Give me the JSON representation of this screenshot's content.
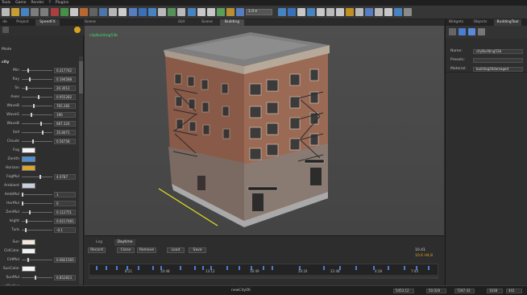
{
  "menubar": {
    "items": [
      "Tools",
      "Game",
      "Render",
      "?",
      "Plugins"
    ]
  },
  "toolbar": {
    "zoom_value": "1.0",
    "icons": [
      "file-icon",
      "open-icon",
      "save-icon",
      "undo-icon",
      "redo-icon",
      "cut-icon",
      "copy-icon",
      "paste-icon",
      "brush-icon",
      "terrain-icon",
      "link-icon",
      "fx-icon",
      "settings-icon",
      "select-icon",
      "move-icon",
      "rotate-icon",
      "scale-icon",
      "grid-icon",
      "snap-icon",
      "camera-icon",
      "text-icon",
      "lock-icon",
      "play-icon",
      "light-icon",
      "sky-icon",
      "water-icon",
      "wind-icon",
      "physics-icon",
      "render-icon",
      "sound-icon",
      "script-icon",
      "debug-icon",
      "layers-icon",
      "help-icon",
      "close-icon",
      "info-icon",
      "stats-icon",
      "fullscreen-icon",
      "options-icon"
    ]
  },
  "left_panel": {
    "tabs": [
      "de",
      "Project",
      "SpeedFX"
    ],
    "active_tab": 2,
    "section_mode": "Mode",
    "section_title": "city",
    "params": [
      {
        "label": "Min",
        "value": "0.217742",
        "knob": 0.2
      },
      {
        "label": "Ray",
        "value": "0.194588",
        "knob": 0.25
      },
      {
        "label": "Sn",
        "value": "20.3012",
        "knob": 0.15
      },
      {
        "label": "Axes",
        "value": "0.955282",
        "knob": 0.55
      },
      {
        "label": "WaveB",
        "value": "765.282",
        "knob": 0.4
      },
      {
        "label": "WaveG",
        "value": "190",
        "knob": 0.3
      },
      {
        "label": "WaveB",
        "value": "687.324",
        "knob": 0.65
      },
      {
        "label": "Sell",
        "value": "35.8471",
        "knob": 0.7
      },
      {
        "label": "Clouds",
        "value": "0.56758",
        "knob": 0.35
      }
    ],
    "colors": [
      {
        "label": "Fog",
        "color": "#f4f4f4"
      },
      {
        "label": "Zenith",
        "color": "#4a90d9"
      },
      {
        "label": "Horizon",
        "color": "#d9a62a"
      }
    ],
    "params2": [
      {
        "label": "FogMul",
        "value": "4.0787",
        "knob": 0.6
      },
      {
        "label": "Ambient",
        "value": "",
        "knob": null,
        "color": "#c8d0e0"
      },
      {
        "label": "AmbMul",
        "value": "1",
        "knob": 0.0
      },
      {
        "label": "HorMul",
        "value": "0",
        "knob": 0.0
      },
      {
        "label": "ZenMul",
        "value": "0.112751",
        "knob": 0.25
      },
      {
        "label": "Isight",
        "value": "0.0217481",
        "knob": 0.15
      },
      {
        "label": "Turb",
        "value": "-0.1",
        "knob": 0.1
      }
    ],
    "colors2": [
      {
        "label": "Sun",
        "color": "#f2e8dc"
      },
      {
        "label": "CldColor",
        "color": "#f0f0f0"
      },
      {
        "label": "CldMul",
        "value": "0.0821565",
        "knob": 0.2
      },
      {
        "label": "SunColor",
        "color": "#f4f4f4"
      },
      {
        "label": "SunMul",
        "value": "0.852823",
        "knob": 0.45
      },
      {
        "label": "pRadius",
        "value": "",
        "knob": null
      }
    ]
  },
  "viewport": {
    "tabs": [
      "Scene",
      "GUI",
      "Scene",
      "Building"
    ],
    "active_tab": 3,
    "info_label": "cityBuilding53b"
  },
  "timeline": {
    "tabs": [
      "Log",
      "Daytime"
    ],
    "active_tab": 1,
    "buttons": [
      "Record",
      "Clone",
      "Remove",
      "Load",
      "Save"
    ],
    "time_value": "10.41",
    "time_value2": "10.6 H4.8",
    "ticks": [
      "8:21",
      "10:48",
      "13:12",
      "16:49",
      "20:24",
      "22:48",
      "4:28",
      "7:44"
    ]
  },
  "right_panel": {
    "tabs": [
      "Widgets",
      "Objects",
      "BuildingTool"
    ],
    "active_tab": 2,
    "fields": [
      {
        "label": "Name:",
        "value": "cityBuilding53b"
      },
      {
        "label": "Presets:",
        "value": ""
      },
      {
        "label": "Material:",
        "value": "building26damaged"
      }
    ]
  },
  "statusbar": {
    "center": "newCity06",
    "values": [
      "5453.12",
      "50.028",
      "7287.43",
      "1038",
      "441"
    ]
  }
}
